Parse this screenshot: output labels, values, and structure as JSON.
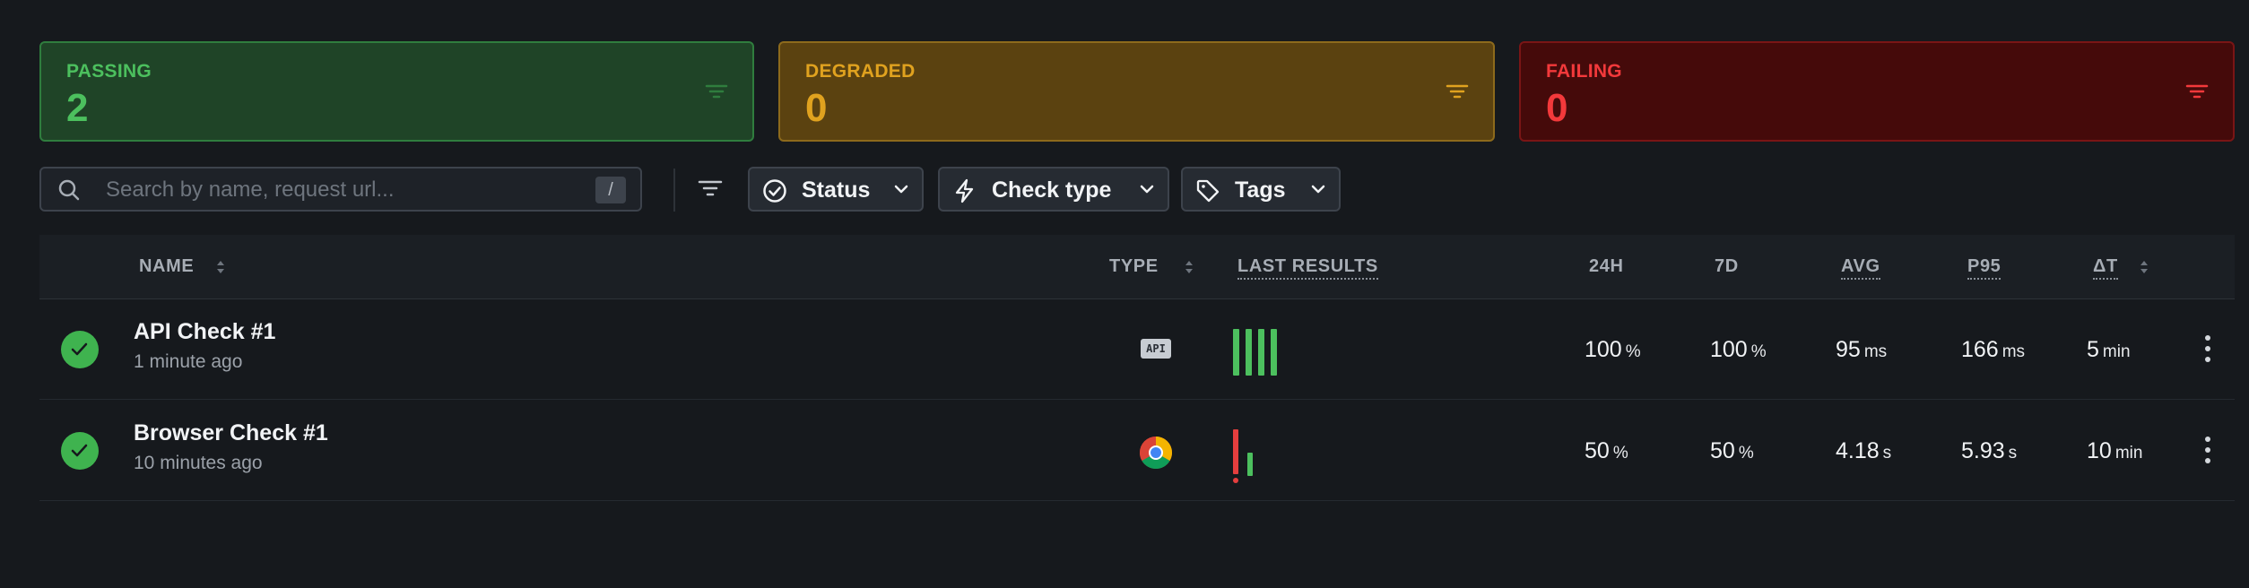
{
  "summary": {
    "passing": {
      "label": "PASSING",
      "count": "2"
    },
    "degraded": {
      "label": "DEGRADED",
      "count": "0"
    },
    "failing": {
      "label": "FAILING",
      "count": "0"
    }
  },
  "search": {
    "placeholder": "Search by name, request url...",
    "value": "",
    "shortcut": "/"
  },
  "filters": {
    "status": "Status",
    "check_type": "Check type",
    "tags": "Tags"
  },
  "table": {
    "columns": {
      "name": "NAME",
      "type": "TYPE",
      "last_results": "LAST RESULTS",
      "h24": "24H",
      "d7": "7D",
      "avg": "AVG",
      "p95": "P95",
      "dt": "ΔT"
    },
    "rows": [
      {
        "name": "API Check #1",
        "time": "1 minute ago",
        "type": "api",
        "type_badge": "API",
        "results": [
          "pass",
          "pass",
          "pass",
          "pass"
        ],
        "h24": {
          "value": "100",
          "unit": "%"
        },
        "d7": {
          "value": "100",
          "unit": "%"
        },
        "avg": {
          "value": "95",
          "unit": "ms"
        },
        "p95": {
          "value": "166",
          "unit": "ms"
        },
        "dt": {
          "value": "5",
          "unit": "min"
        }
      },
      {
        "name": "Browser Check #1",
        "time": "10 minutes ago",
        "type": "browser",
        "results": [
          "fail",
          "pass"
        ],
        "h24": {
          "value": "50",
          "unit": "%"
        },
        "d7": {
          "value": "50",
          "unit": "%"
        },
        "avg": {
          "value": "4.18",
          "unit": "s"
        },
        "p95": {
          "value": "5.93",
          "unit": "s"
        },
        "dt": {
          "value": "10",
          "unit": "min"
        }
      }
    ]
  },
  "colors": {
    "pass": "#4cc05e",
    "fail": "#e53e3e",
    "degraded": "#e0a21f"
  },
  "icons": [
    "search-icon",
    "filter-icon",
    "check-circle-icon",
    "lightning-icon",
    "tag-icon",
    "chevron-down-icon",
    "sort-icon",
    "chrome-icon",
    "kebab-icon"
  ]
}
